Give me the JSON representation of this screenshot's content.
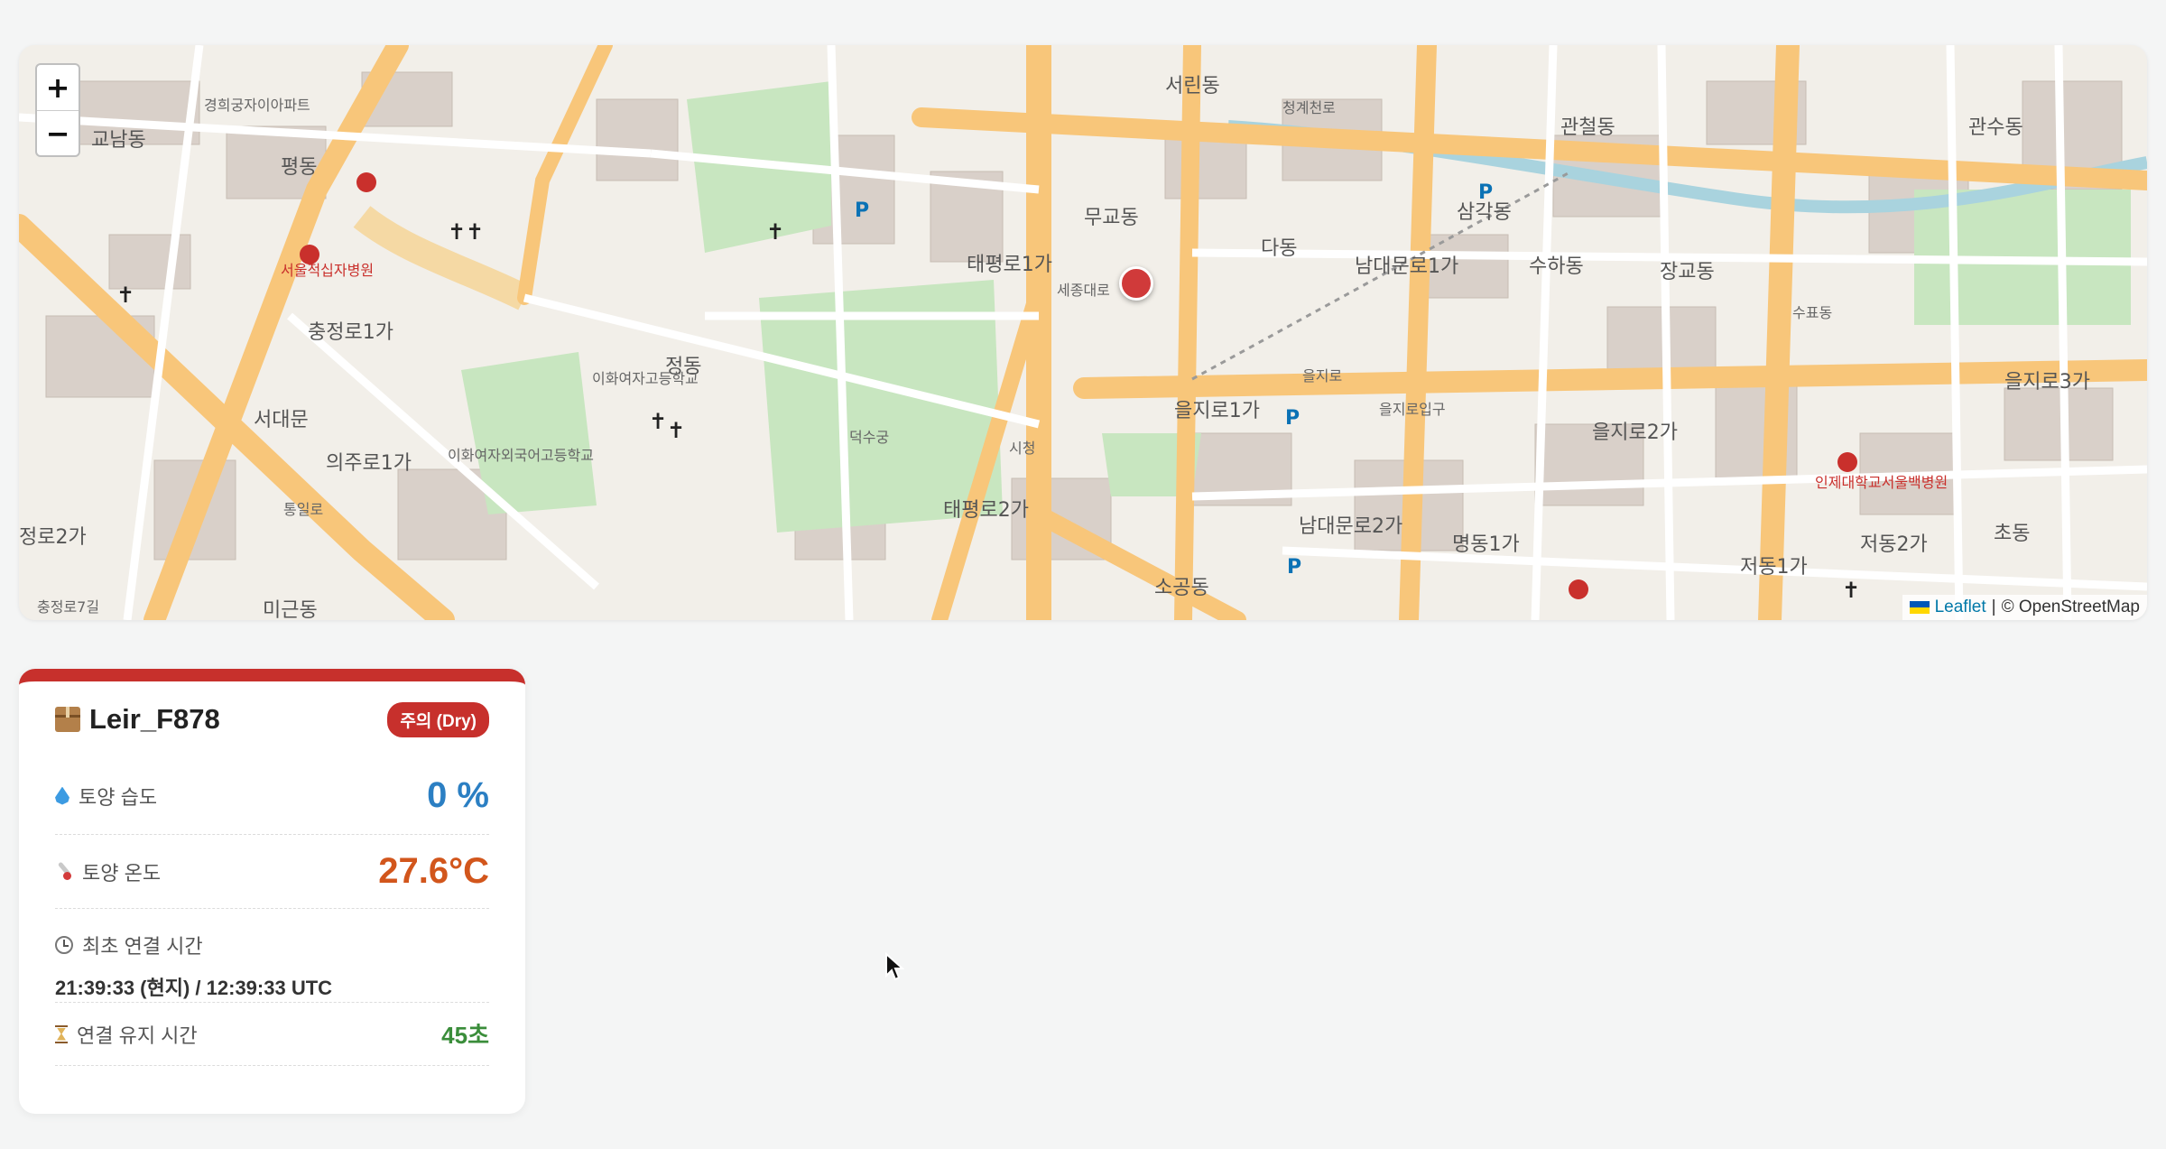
{
  "map": {
    "zoom_in": "+",
    "zoom_out": "−",
    "attribution": {
      "leaflet": "Leaflet",
      "separator": "|",
      "osm": "© OpenStreetMap"
    },
    "labels": [
      "서린동",
      "관철동",
      "관수동",
      "무교동",
      "다동",
      "태평로1가",
      "남대문로1가",
      "삼각동",
      "수하동",
      "장교동",
      "정동",
      "충정로1가",
      "서대문",
      "의주로1가",
      "을지로1가",
      "을지로2가",
      "을지로3가",
      "태평로2가",
      "남대문로2가",
      "명동1가",
      "저동1가",
      "저동2가",
      "소공동",
      "미근동",
      "평동",
      "교남동",
      "정로2가",
      "초동",
      "시청",
      "을지로입구",
      "수표동",
      "세종대로",
      "청계천로",
      "서울적십자병원",
      "이화여자외국어고등학교",
      "이화여자고등학교",
      "덕수궁",
      "인제대학교서울백병원",
      "통일로",
      "경희궁자이아파트",
      "충정로7길",
      "을지로"
    ]
  },
  "card": {
    "accent_color": "#c7302c",
    "device_icon": "package-icon",
    "device_name": "Leir_F878",
    "status_badge": "주의 (Dry)",
    "soil_moisture": {
      "icon": "droplet-icon",
      "label": "토양 습도",
      "value": "0 %"
    },
    "soil_temp": {
      "icon": "thermometer-icon",
      "label": "토양 온도",
      "value": "27.6°C"
    },
    "first_connected": {
      "icon": "clock-icon",
      "label": "최초 연결 시간",
      "value": "21:39:33 (현지) / 12:39:33 UTC"
    },
    "uptime": {
      "icon": "hourglass-icon",
      "label": "연결 유지 시간",
      "value": "45초"
    }
  }
}
